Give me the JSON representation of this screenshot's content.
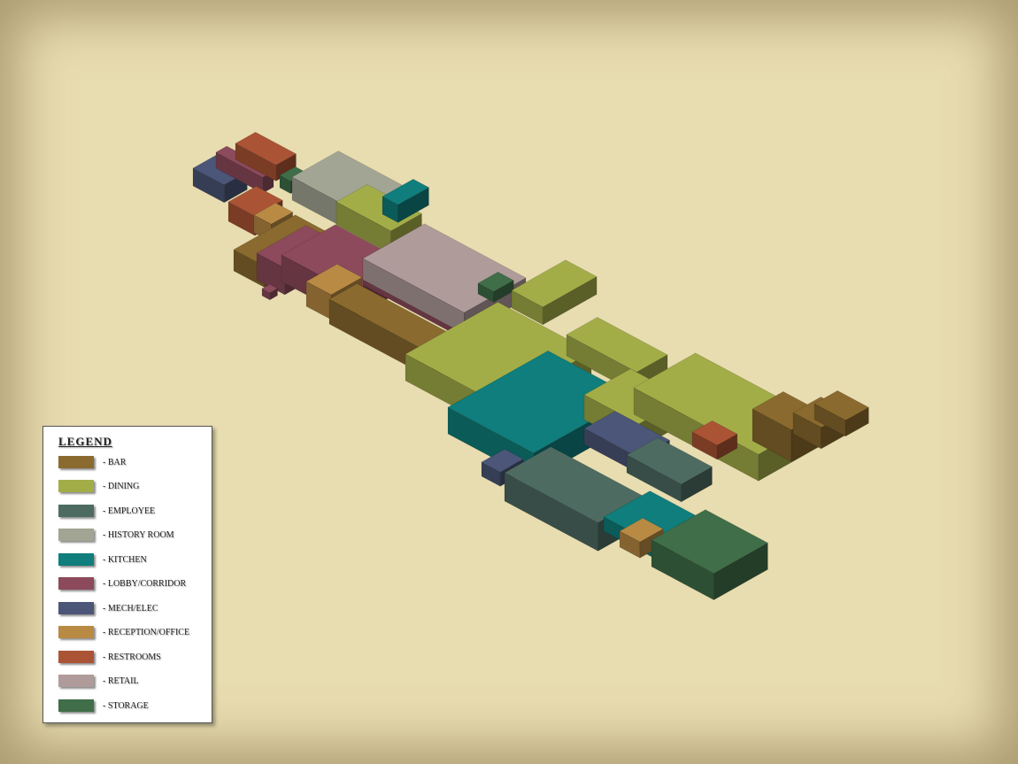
{
  "legend": {
    "title": "LEGEND",
    "items": [
      {
        "key": "bar",
        "label": "- BAR",
        "color": "#8a6a2e"
      },
      {
        "key": "dining",
        "label": "- DINING",
        "color": "#a3ad48"
      },
      {
        "key": "employee",
        "label": "- EMPLOYEE",
        "color": "#4e6b62"
      },
      {
        "key": "history",
        "label": "- HISTORY ROOM",
        "color": "#a3a594"
      },
      {
        "key": "kitchen",
        "label": "- KITCHEN",
        "color": "#0f7e7c"
      },
      {
        "key": "lobby",
        "label": "- LOBBY/CORRIDOR",
        "color": "#8c4a5c"
      },
      {
        "key": "mech",
        "label": "- MECH/ELEC",
        "color": "#4b5678"
      },
      {
        "key": "reception",
        "label": "- RECEPTION/OFFICE",
        "color": "#b88a44"
      },
      {
        "key": "restrooms",
        "label": "- RESTROOMS",
        "color": "#ab5435"
      },
      {
        "key": "retail",
        "label": "- RETAIL",
        "color": "#b09b9b"
      },
      {
        "key": "storage",
        "label": "- STORAGE",
        "color": "#3f6e48"
      }
    ]
  }
}
